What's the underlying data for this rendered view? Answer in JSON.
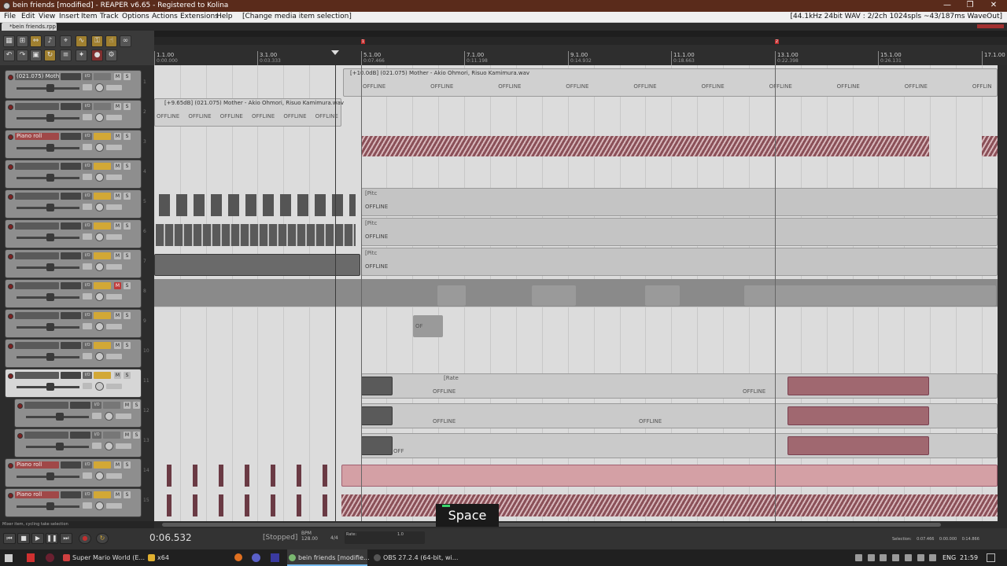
{
  "window": {
    "title": "bein friends [modified] - REAPER v6.65 - Registered to Kolina",
    "minimize": "—",
    "maximize": "❐",
    "close": "✕"
  },
  "menu": [
    "File",
    "Edit",
    "View",
    "Insert",
    "Item",
    "Track",
    "Options",
    "Actions",
    "Extensions",
    "Help"
  ],
  "menu_context": "[Change media item selection]",
  "menu_status": "[44.1kHz 24bit WAV : 2/2ch 1024spls ~43/187ms WaveOut]",
  "project_tab": "*bein friends.rpp",
  "ruler": {
    "markers": [
      {
        "label": "1.1.00",
        "sub": "0:00.000"
      },
      {
        "label": "3.1.00",
        "sub": "0:03.333"
      },
      {
        "label": "5.1.00",
        "sub": "0:07.466"
      },
      {
        "label": "7.1.00",
        "sub": "0:11.198"
      },
      {
        "label": "9.1.00",
        "sub": "0:14.932"
      },
      {
        "label": "11.1.00",
        "sub": "0:18.663"
      },
      {
        "label": "13.1.00",
        "sub": "0:22.398"
      },
      {
        "label": "15.1.00",
        "sub": "0:26.131"
      },
      {
        "label": "17.1.00",
        "sub": ""
      }
    ],
    "region_marks": [
      "1",
      "2"
    ]
  },
  "tracks": [
    {
      "name": "(021.075) Mothe",
      "fx": false,
      "mute": false,
      "num": "1"
    },
    {
      "name": "",
      "fx": false,
      "mute": false,
      "num": "2"
    },
    {
      "name": "Piano roll",
      "fx": true,
      "mute": false,
      "num": "3"
    },
    {
      "name": "",
      "fx": true,
      "mute": false,
      "num": "4"
    },
    {
      "name": "",
      "fx": true,
      "mute": false,
      "num": "5"
    },
    {
      "name": "",
      "fx": true,
      "mute": false,
      "num": "6"
    },
    {
      "name": "",
      "fx": true,
      "mute": false,
      "num": "7"
    },
    {
      "name": "",
      "fx": true,
      "mute": true,
      "num": "8"
    },
    {
      "name": "",
      "fx": true,
      "mute": false,
      "num": "9"
    },
    {
      "name": "",
      "fx": true,
      "mute": false,
      "num": "10"
    },
    {
      "name": "",
      "fx": true,
      "mute": false,
      "num": "11",
      "selected": true
    },
    {
      "name": "",
      "fx": false,
      "mute": false,
      "num": "12"
    },
    {
      "name": "",
      "fx": false,
      "mute": false,
      "num": "13"
    },
    {
      "name": "Piano roll",
      "fx": true,
      "mute": false,
      "num": "14"
    },
    {
      "name": "Piano roll",
      "fx": true,
      "mute": false,
      "num": "15"
    }
  ],
  "track_labels": {
    "io": "I/O",
    "mute": "M",
    "solo": "S"
  },
  "items": {
    "take1": "[+10.0dB] (021.075) Mother - Akio Ohmori, Risuo Kamimura.wav",
    "take2": "[+9.65dB] (021.075) Mother - Akio Ohmori, Risuo Kamimura.wav",
    "offline": "OFFLINE",
    "offline_short": "OFF",
    "pitch": "[Pitch",
    "pitch_short": "[Pitc",
    "rate": "[Rate",
    "of": "OF"
  },
  "tcp_status": "Mixer item, cycling take selection",
  "transport": {
    "time": "0:06.532",
    "state": "[Stopped]",
    "bpm_label": "BPM",
    "bpm": "128.00",
    "timesig": "4/4",
    "rate_label": "Rate:",
    "rate": "1.0",
    "selection_label": "Selection:",
    "sel_start": "0:07.466",
    "sel_end": "0:00.000",
    "sel_len": "0:14.866"
  },
  "keycast": "Space",
  "taskbar": {
    "apps": [
      {
        "label": "Super Mario World (E...",
        "color": "#d04040"
      },
      {
        "label": "x64",
        "color": "#e0b030"
      },
      {
        "label": "bein friends [modifie...",
        "color": "#7ab870",
        "active": true
      },
      {
        "label": "OBS 27.2.4 (64-bit, wi...",
        "color": "#444444"
      }
    ],
    "lang": "ENG",
    "clock": "21:59"
  },
  "colors": {
    "accent": "#d2a836",
    "titlebar": "#5a2b1b",
    "item_pink": "#d4a0a5"
  }
}
